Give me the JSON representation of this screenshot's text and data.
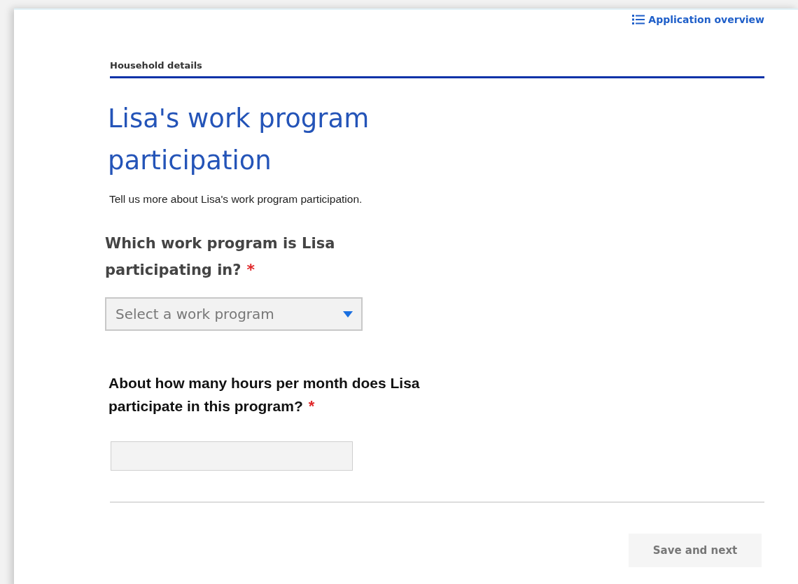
{
  "header": {
    "overview_link": "Application overview"
  },
  "section": {
    "label": "Household details"
  },
  "title": "Lisa's work program participation",
  "intro": "Tell us more about Lisa's work program participation.",
  "questions": [
    {
      "kind": "select",
      "label": "Which work program is Lisa participating in?",
      "required_mark": "*",
      "placeholder": "Select a work program"
    },
    {
      "kind": "text",
      "label": "About how many hours per month does Lisa participate in this program?",
      "required_mark": "*"
    }
  ],
  "buttons": [
    {
      "label": "Save and next",
      "disabled": true
    }
  ]
}
